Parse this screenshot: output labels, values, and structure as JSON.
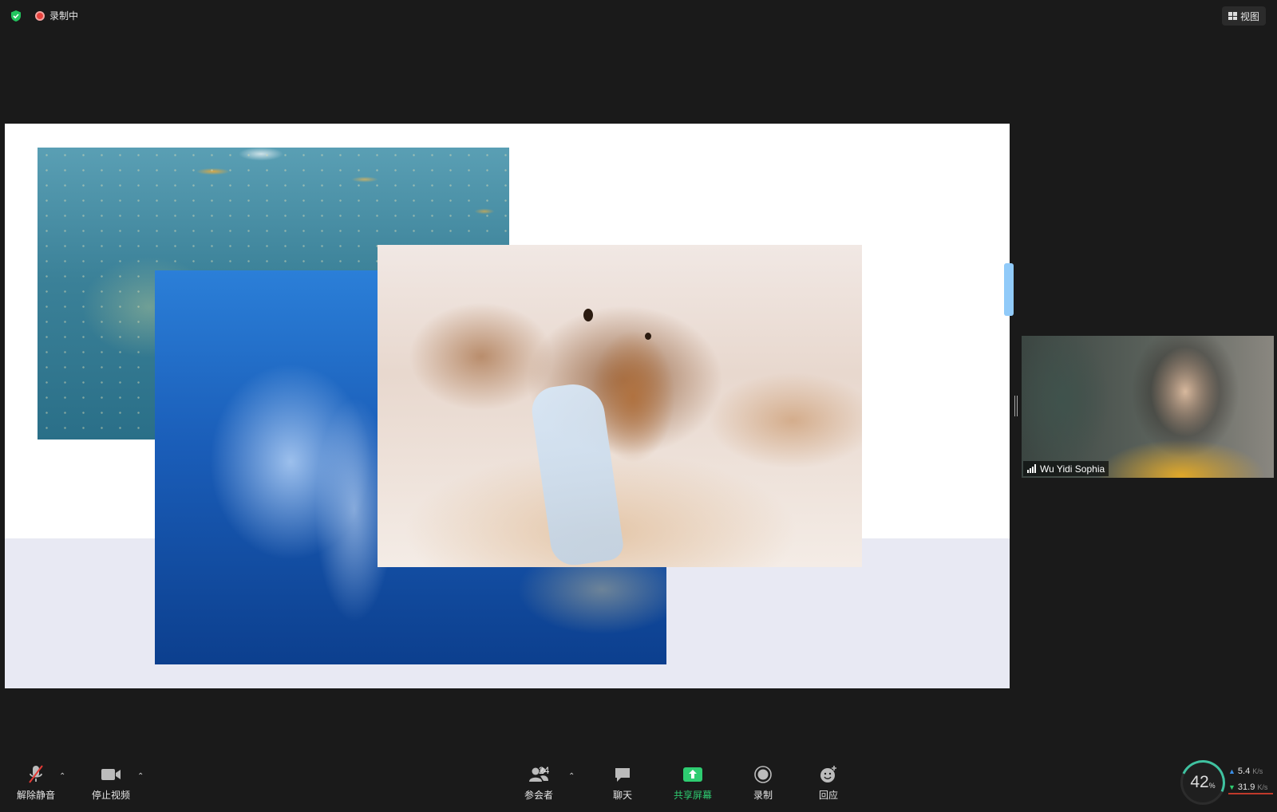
{
  "top_bar": {
    "recording_status": "录制中",
    "view_label": "视图"
  },
  "participant": {
    "name": "Wu Yidi Sophia"
  },
  "toolbar": {
    "unmute_label": "解除静音",
    "stop_video_label": "停止视频",
    "participants_label": "参会者",
    "participants_count": "24",
    "chat_label": "聊天",
    "share_screen_label": "共享屏幕",
    "record_label": "录制",
    "reactions_label": "回应"
  },
  "network": {
    "cpu_percent": "42",
    "cpu_unit": "%",
    "upload_value": "5.4",
    "download_value": "31.9",
    "speed_unit": "K/s"
  },
  "colors": {
    "background": "#1a1a1a",
    "share_accent": "#2ecc71",
    "recording_red": "#e8413c",
    "security_green": "#22c55e"
  }
}
